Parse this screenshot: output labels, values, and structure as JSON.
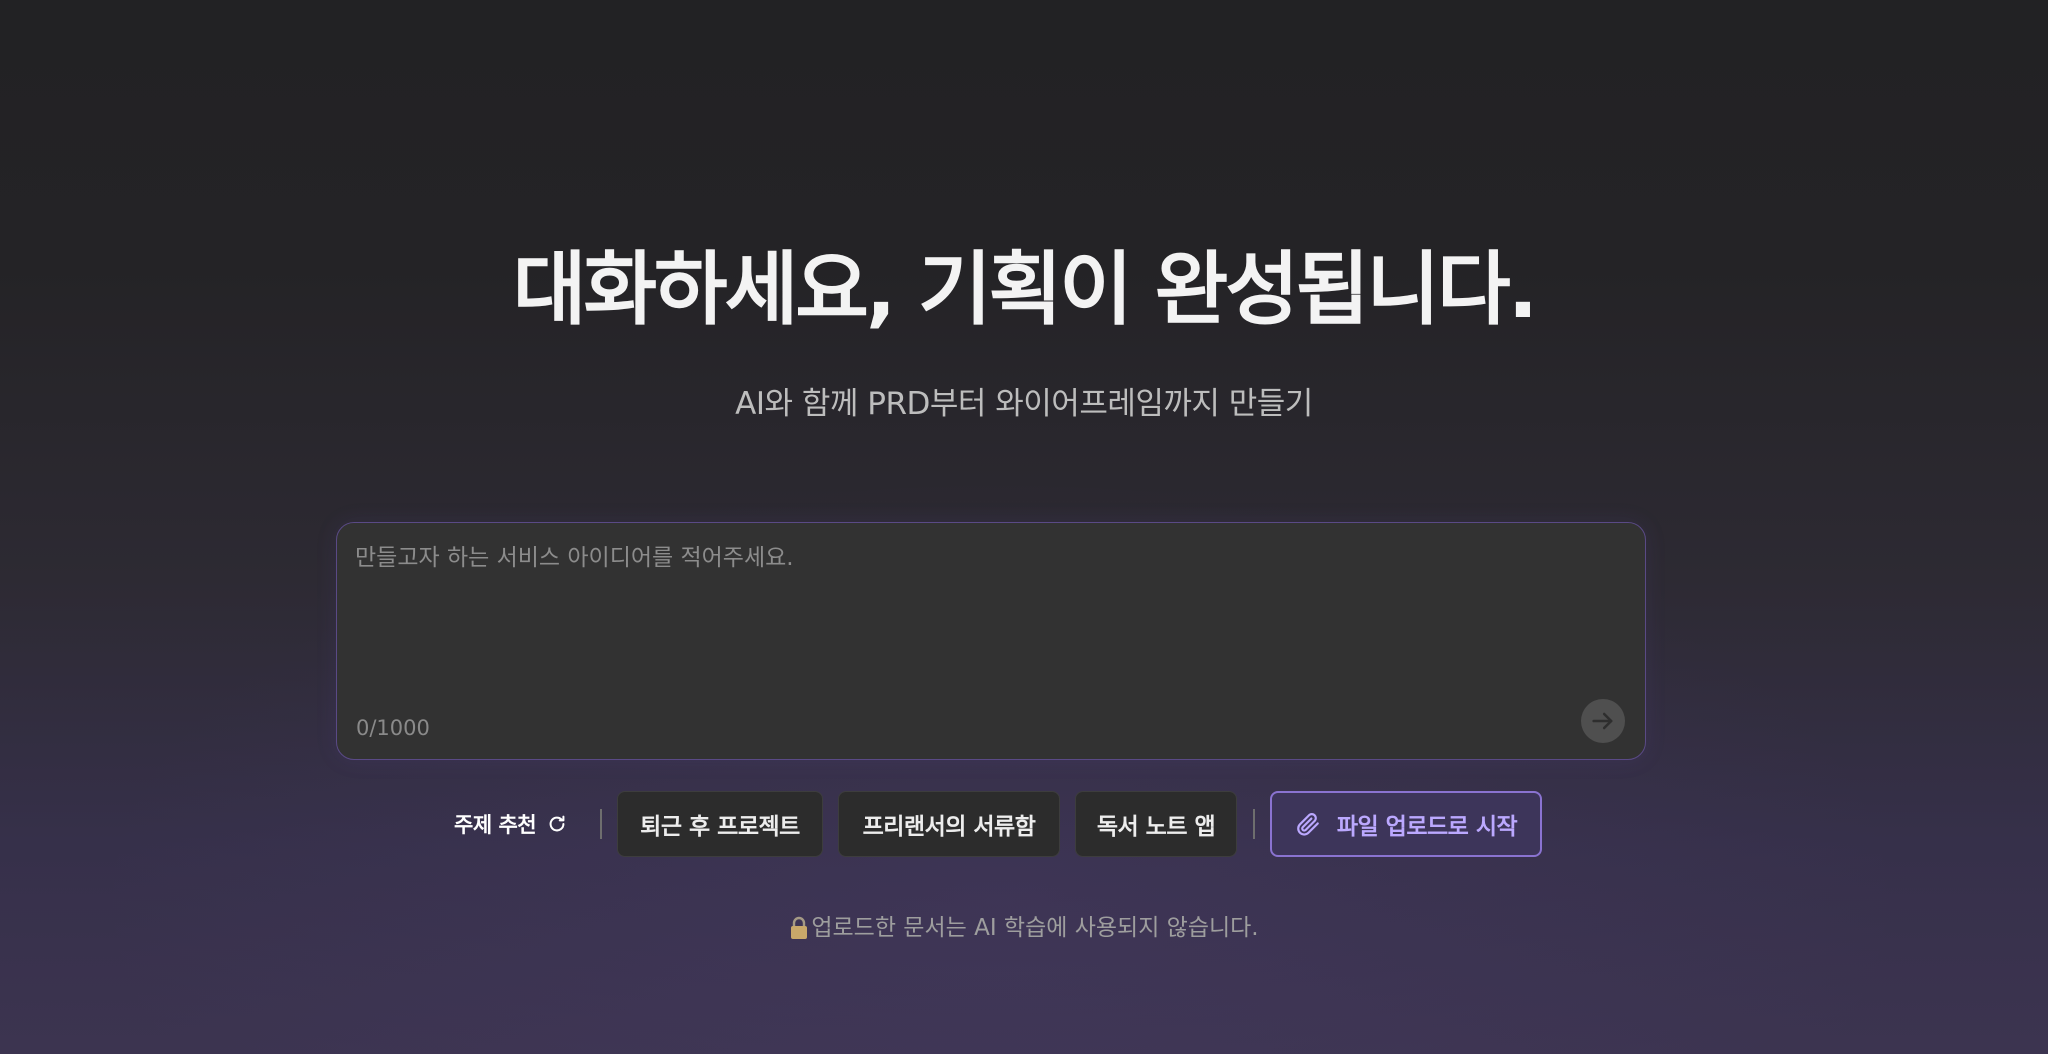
{
  "hero": {
    "title": "대화하세요, 기획이 완성됩니다.",
    "subtitle": "AI와 함께 PRD부터 와이어프레임까지 만들기"
  },
  "composer": {
    "value": "",
    "placeholder": "만들고자 하는 서비스 아이디어를 적어주세요.",
    "char_count": "0/1000",
    "send_icon": "arrow-right-icon"
  },
  "suggestions": {
    "label": "주제 추천",
    "refresh_icon": "refresh-icon",
    "chips": [
      {
        "label": "퇴근 후 프로젝트"
      },
      {
        "label": "프리랜서의 서류함"
      },
      {
        "label": "독서 노트 앱"
      }
    ],
    "upload": {
      "label": "파일 업로드로 시작",
      "icon": "paperclip-icon"
    }
  },
  "notice": {
    "icon": "lock-icon",
    "text": "업로드한 문서는 AI 학습에 사용되지 않습니다."
  },
  "colors": {
    "accent": "#8a73d1",
    "accent_text": "#bba8ff",
    "input_border": "#5a4a86"
  }
}
